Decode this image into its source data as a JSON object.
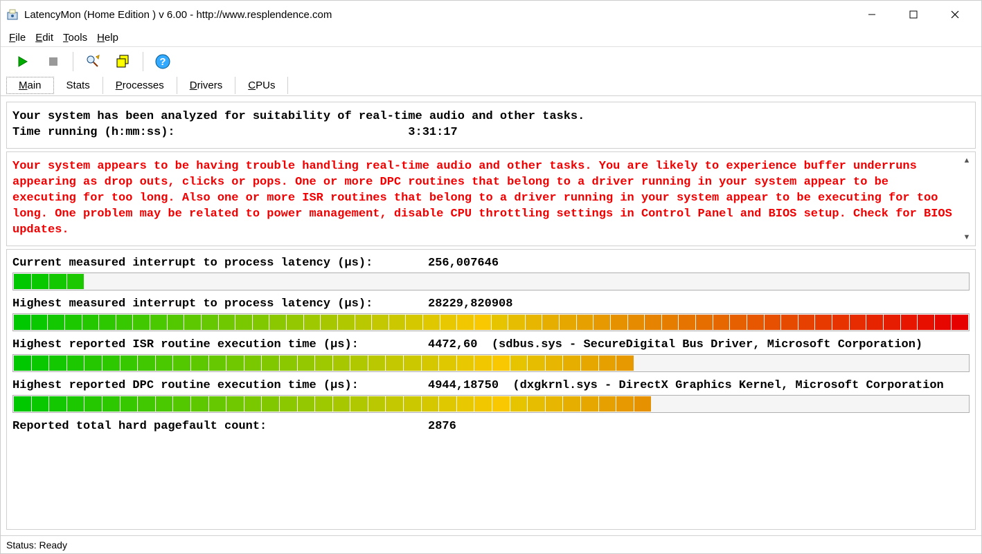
{
  "window": {
    "title": "LatencyMon  (Home Edition )  v 6.00 - http://www.resplendence.com"
  },
  "menu": {
    "file": "File",
    "edit": "Edit",
    "tools": "Tools",
    "help": "Help"
  },
  "tabs": {
    "main": "Main",
    "stats": "Stats",
    "processes": "Processes",
    "drivers": "Drivers",
    "cpus": "CPUs"
  },
  "header": {
    "line1": "Your system has been analyzed for suitability of real-time audio and other tasks.",
    "time_label": "Time running (h:mm:ss):",
    "time_value": "3:31:17"
  },
  "warning": "Your system appears to be having trouble handling real-time audio and other tasks. You are likely to experience buffer underruns appearing as drop outs, clicks or pops. One or more DPC routines that belong to a driver running in your system appear to be executing for too long. Also one or more ISR routines that belong to a driver running in your system appear to be executing for too long. One problem may be related to power management, disable CPU throttling settings in Control Panel and BIOS setup. Check for BIOS updates.",
  "metrics": [
    {
      "label": "Current measured interrupt to process latency (µs):",
      "value": "256,007646",
      "extra": "",
      "fill_pct": 7,
      "segments": 4
    },
    {
      "label": "Highest measured interrupt to process latency (µs):",
      "value": "28229,820908",
      "extra": "",
      "fill_pct": 100,
      "segments": 56
    },
    {
      "label": "Highest reported ISR routine execution time (µs):",
      "value": "4472,60",
      "extra": "  (sdbus.sys - SecureDigital Bus Driver, Microsoft Corporation)",
      "fill_pct": 62,
      "segments": 35
    },
    {
      "label": "Highest reported DPC routine execution time (µs):",
      "value": "4944,18750",
      "extra": "  (dxgkrnl.sys - DirectX Graphics Kernel, Microsoft Corporation",
      "fill_pct": 63,
      "segments": 36
    },
    {
      "label": "Reported total hard pagefault count:",
      "value": "2876",
      "extra": "",
      "fill_pct": -1,
      "segments": 0
    }
  ],
  "status": "Status: Ready"
}
